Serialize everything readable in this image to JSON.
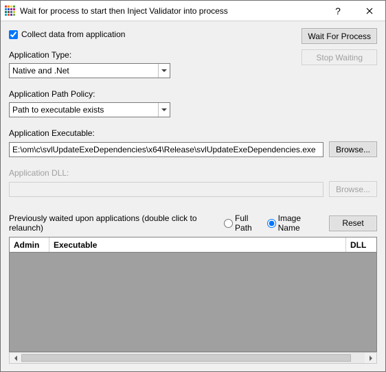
{
  "window": {
    "title": "Wait for process to start then Inject Validator into process"
  },
  "checkbox": {
    "collect_label": "Collect data from application",
    "collect_checked": true
  },
  "buttons": {
    "wait_for_process": "Wait For Process",
    "stop_waiting": "Stop Waiting",
    "browse_exe": "Browse...",
    "browse_dll": "Browse...",
    "reset": "Reset"
  },
  "labels": {
    "app_type": "Application Type:",
    "app_path_policy": "Application Path Policy:",
    "app_executable": "Application Executable:",
    "app_dll": "Application DLL:",
    "prev_waited": "Previously waited upon applications (double click to relaunch)",
    "full_path": "Full Path",
    "image_name": "Image Name"
  },
  "fields": {
    "app_type_value": "Native and .Net",
    "app_path_policy_value": "Path to executable exists",
    "app_executable_value": "E:\\om\\c\\svlUpdateExeDependencies\\x64\\Release\\svlUpdateExeDependencies.exe",
    "app_dll_value": ""
  },
  "radio": {
    "selected": "image_name"
  },
  "table": {
    "columns": {
      "admin": "Admin",
      "executable": "Executable",
      "dll": "DLL"
    },
    "rows": []
  },
  "icon_colors": [
    "#E53935",
    "#FB8C00",
    "#FDD835",
    "#43A047",
    "#1E88E5",
    "#3949AB",
    "#8E24AA",
    "#D81B60",
    "#00897B",
    "#6D4C41",
    "#546E7A",
    "#C0CA33",
    "#00ACC1",
    "#F4511E",
    "#5E35B1",
    "#7CB342"
  ]
}
